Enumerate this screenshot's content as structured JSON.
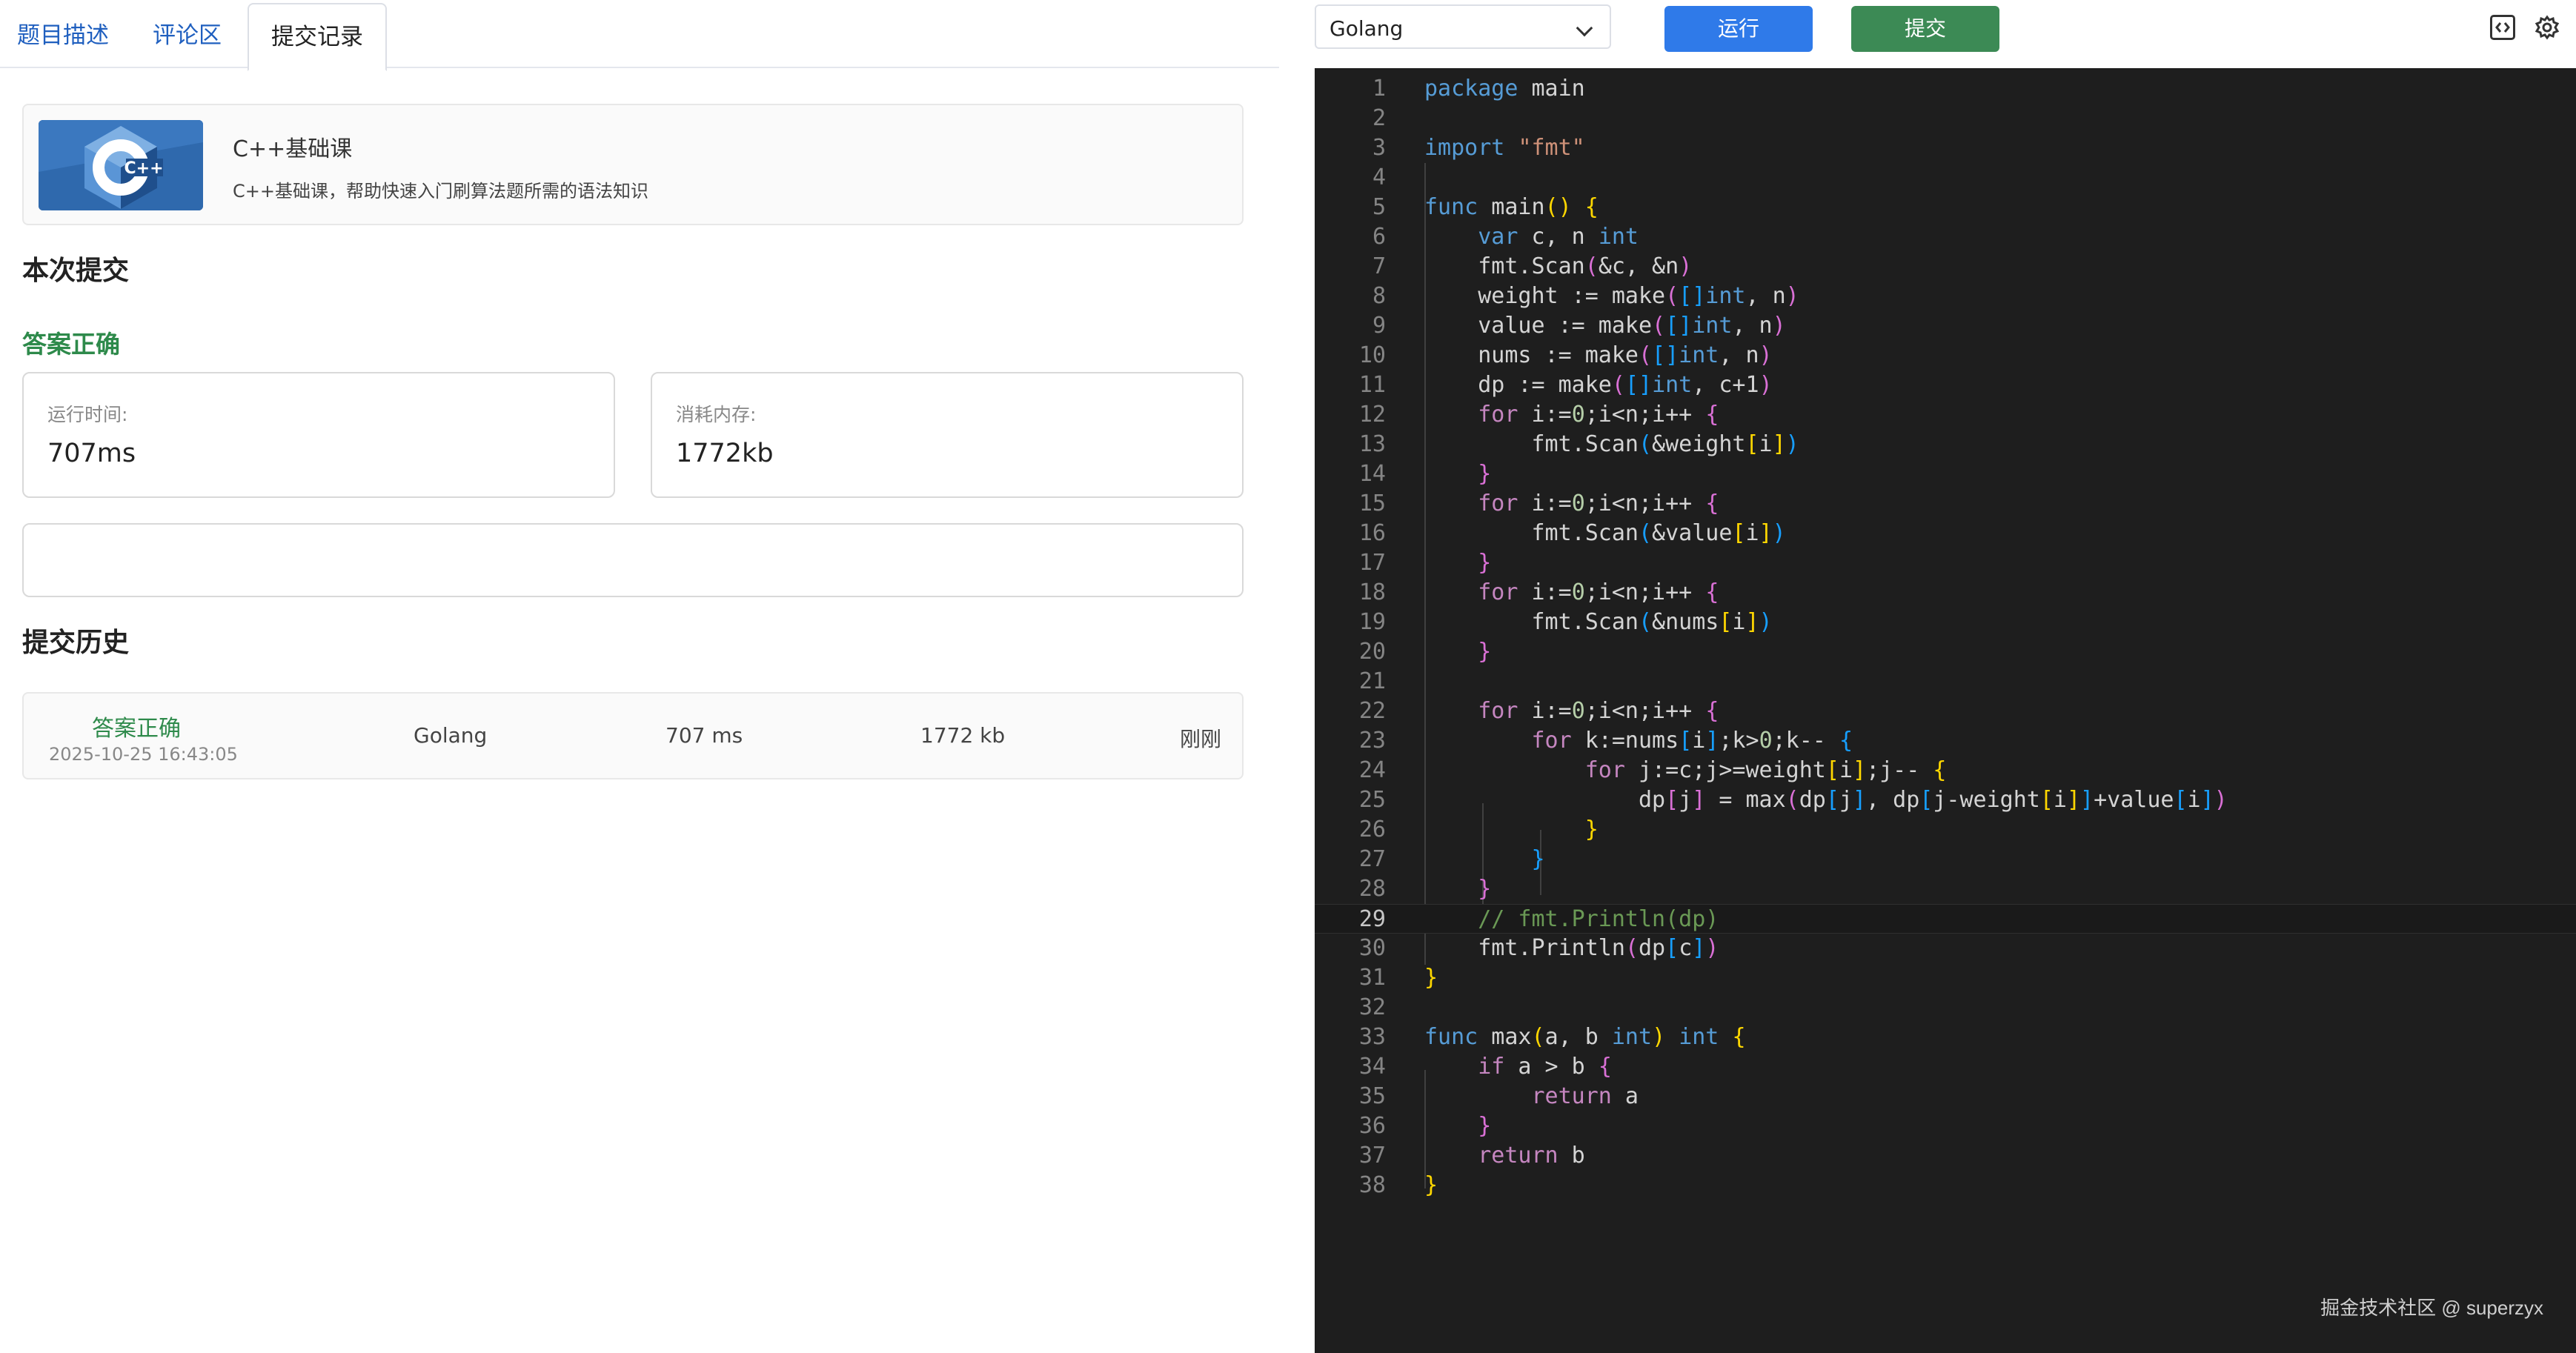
{
  "tabs": [
    "题目描述",
    "评论区",
    "提交记录"
  ],
  "course": {
    "title": "C++基础课",
    "desc": "C++基础课，帮助快速入门刷算法题所需的语法知识",
    "logo_text": "C++"
  },
  "current": {
    "heading": "本次提交",
    "status": "答案正确",
    "runtime_label": "运行时间:",
    "runtime_value": "707ms",
    "memory_label": "消耗内存:",
    "memory_value": "1772kb"
  },
  "history": {
    "heading": "提交历史",
    "rows": [
      {
        "status": "答案正确",
        "date": "2025-10-25 16:43:05",
        "lang": "Golang",
        "time": "707 ms",
        "mem": "1772 kb",
        "when": "刚刚"
      }
    ]
  },
  "toolbar": {
    "language": "Golang",
    "run_label": "运行",
    "submit_label": "提交"
  },
  "editor": {
    "current_line": 29,
    "lines": [
      [
        [
          "package",
          "kw"
        ],
        [
          " main",
          ""
        ]
      ],
      [],
      [
        [
          "import",
          "kw"
        ],
        [
          " ",
          ""
        ],
        [
          "\"fmt\"",
          "str"
        ]
      ],
      [],
      [
        [
          "func",
          "kw"
        ],
        [
          " main",
          ""
        ],
        [
          "()",
          "b1"
        ],
        [
          " ",
          ""
        ],
        [
          "{",
          "b1"
        ]
      ],
      [
        [
          "    ",
          ""
        ],
        [
          "var",
          "kw"
        ],
        [
          " c, n ",
          ""
        ],
        [
          "int",
          "kw"
        ]
      ],
      [
        [
          "    fmt.Scan",
          ""
        ],
        [
          "(",
          "b2"
        ],
        [
          "&c, &n",
          ""
        ],
        [
          ")",
          "b2"
        ]
      ],
      [
        [
          "    weight := make",
          ""
        ],
        [
          "(",
          "b2"
        ],
        [
          "[]",
          "b3"
        ],
        [
          "int",
          "kw"
        ],
        [
          ", n",
          ""
        ],
        [
          ")",
          "b2"
        ]
      ],
      [
        [
          "    value := make",
          ""
        ],
        [
          "(",
          "b2"
        ],
        [
          "[]",
          "b3"
        ],
        [
          "int",
          "kw"
        ],
        [
          ", n",
          ""
        ],
        [
          ")",
          "b2"
        ]
      ],
      [
        [
          "    nums := make",
          ""
        ],
        [
          "(",
          "b2"
        ],
        [
          "[]",
          "b3"
        ],
        [
          "int",
          "kw"
        ],
        [
          ", n",
          ""
        ],
        [
          ")",
          "b2"
        ]
      ],
      [
        [
          "    dp := make",
          ""
        ],
        [
          "(",
          "b2"
        ],
        [
          "[]",
          "b3"
        ],
        [
          "int",
          "kw"
        ],
        [
          ", c+1",
          ""
        ],
        [
          ")",
          "b2"
        ]
      ],
      [
        [
          "    ",
          ""
        ],
        [
          "for",
          "ctl"
        ],
        [
          " i:=",
          ""
        ],
        [
          "0",
          "num"
        ],
        [
          ";i<n;i++ ",
          ""
        ],
        [
          "{",
          "b2"
        ]
      ],
      [
        [
          "        fmt.Scan",
          ""
        ],
        [
          "(",
          "b3"
        ],
        [
          "&weight",
          ""
        ],
        [
          "[",
          "b1"
        ],
        [
          "i",
          ""
        ],
        [
          "]",
          "b1"
        ],
        [
          ")",
          "b3"
        ]
      ],
      [
        [
          "    ",
          ""
        ],
        [
          "}",
          "b2"
        ]
      ],
      [
        [
          "    ",
          ""
        ],
        [
          "for",
          "ctl"
        ],
        [
          " i:=",
          ""
        ],
        [
          "0",
          "num"
        ],
        [
          ";i<n;i++ ",
          ""
        ],
        [
          "{",
          "b2"
        ]
      ],
      [
        [
          "        fmt.Scan",
          ""
        ],
        [
          "(",
          "b3"
        ],
        [
          "&value",
          ""
        ],
        [
          "[",
          "b1"
        ],
        [
          "i",
          ""
        ],
        [
          "]",
          "b1"
        ],
        [
          ")",
          "b3"
        ]
      ],
      [
        [
          "    ",
          ""
        ],
        [
          "}",
          "b2"
        ]
      ],
      [
        [
          "    ",
          ""
        ],
        [
          "for",
          "ctl"
        ],
        [
          " i:=",
          ""
        ],
        [
          "0",
          "num"
        ],
        [
          ";i<n;i++ ",
          ""
        ],
        [
          "{",
          "b2"
        ]
      ],
      [
        [
          "        fmt.Scan",
          ""
        ],
        [
          "(",
          "b3"
        ],
        [
          "&nums",
          ""
        ],
        [
          "[",
          "b1"
        ],
        [
          "i",
          ""
        ],
        [
          "]",
          "b1"
        ],
        [
          ")",
          "b3"
        ]
      ],
      [
        [
          "    ",
          ""
        ],
        [
          "}",
          "b2"
        ]
      ],
      [],
      [
        [
          "    ",
          ""
        ],
        [
          "for",
          "ctl"
        ],
        [
          " i:=",
          ""
        ],
        [
          "0",
          "num"
        ],
        [
          ";i<n;i++ ",
          ""
        ],
        [
          "{",
          "b2"
        ]
      ],
      [
        [
          "        ",
          ""
        ],
        [
          "for",
          "ctl"
        ],
        [
          " k:=nums",
          ""
        ],
        [
          "[",
          "b3"
        ],
        [
          "i",
          ""
        ],
        [
          "]",
          "b3"
        ],
        [
          ";k>",
          ""
        ],
        [
          "0",
          "num"
        ],
        [
          ";k-- ",
          ""
        ],
        [
          "{",
          "b3"
        ]
      ],
      [
        [
          "            ",
          ""
        ],
        [
          "for",
          "ctl"
        ],
        [
          " j:=c;j>=weight",
          ""
        ],
        [
          "[",
          "b1"
        ],
        [
          "i",
          ""
        ],
        [
          "]",
          "b1"
        ],
        [
          ";j-- ",
          ""
        ],
        [
          "{",
          "b1"
        ]
      ],
      [
        [
          "                dp",
          ""
        ],
        [
          "[",
          "b2"
        ],
        [
          "j",
          ""
        ],
        [
          "]",
          "b2"
        ],
        [
          " = max",
          ""
        ],
        [
          "(",
          "b2"
        ],
        [
          "dp",
          ""
        ],
        [
          "[",
          "b3"
        ],
        [
          "j",
          ""
        ],
        [
          "]",
          "b3"
        ],
        [
          ", dp",
          ""
        ],
        [
          "[",
          "b3"
        ],
        [
          "j-weight",
          ""
        ],
        [
          "[",
          "b1"
        ],
        [
          "i",
          ""
        ],
        [
          "]",
          "b1"
        ],
        [
          "]",
          "b3"
        ],
        [
          "+value",
          ""
        ],
        [
          "[",
          "b3"
        ],
        [
          "i",
          ""
        ],
        [
          "]",
          "b3"
        ],
        [
          ")",
          "b2"
        ]
      ],
      [
        [
          "            ",
          ""
        ],
        [
          "}",
          "b1"
        ]
      ],
      [
        [
          "        ",
          ""
        ],
        [
          "}",
          "b3"
        ]
      ],
      [
        [
          "    ",
          ""
        ],
        [
          "}",
          "b2"
        ]
      ],
      [
        [
          "    ",
          ""
        ],
        [
          "// fmt.Println(dp)",
          "cmt"
        ]
      ],
      [
        [
          "    fmt.Println",
          ""
        ],
        [
          "(",
          "b2"
        ],
        [
          "dp",
          ""
        ],
        [
          "[",
          "b3"
        ],
        [
          "c",
          ""
        ],
        [
          "]",
          "b3"
        ],
        [
          ")",
          "b2"
        ]
      ],
      [
        [
          "}",
          "b1"
        ]
      ],
      [],
      [
        [
          "func",
          "kw"
        ],
        [
          " max",
          ""
        ],
        [
          "(",
          "b1"
        ],
        [
          "a, b ",
          ""
        ],
        [
          "int",
          "kw"
        ],
        [
          ")",
          "b1"
        ],
        [
          " ",
          ""
        ],
        [
          "int",
          "kw"
        ],
        [
          " ",
          ""
        ],
        [
          "{",
          "b1"
        ]
      ],
      [
        [
          "    ",
          ""
        ],
        [
          "if",
          "ctl"
        ],
        [
          " a > b ",
          ""
        ],
        [
          "{",
          "b2"
        ]
      ],
      [
        [
          "        ",
          ""
        ],
        [
          "return",
          "ctl"
        ],
        [
          " a",
          ""
        ]
      ],
      [
        [
          "    ",
          ""
        ],
        [
          "}",
          "b2"
        ]
      ],
      [
        [
          "    ",
          ""
        ],
        [
          "return",
          "ctl"
        ],
        [
          " b",
          ""
        ]
      ],
      [
        [
          "}",
          "b1"
        ]
      ]
    ]
  },
  "watermark": "掘金技术社区 @ superzyx"
}
